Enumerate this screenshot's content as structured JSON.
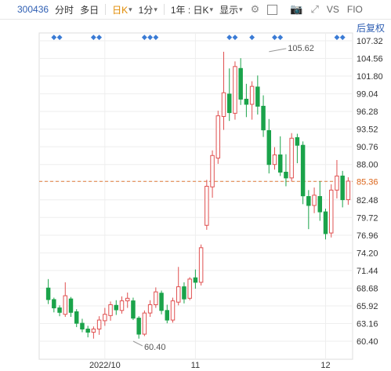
{
  "toolbar": {
    "code": "300436",
    "tabs": [
      "分时",
      "多日",
      "日K",
      "1分",
      "1年 : 日K",
      "显示"
    ],
    "active_tab": "日K",
    "right_labels": [
      "VS",
      "FIO"
    ]
  },
  "restore_label": "后复权",
  "colors": {
    "up": "#e05050",
    "down": "#1aa34a",
    "ref": "#e07a3a",
    "grid": "#eeeeee",
    "axis": "#333333",
    "marker": "#3a7bd5"
  },
  "chart_data": {
    "type": "candlestick",
    "y_ticks": [
      "107.32",
      "104.56",
      "101.80",
      "99.04",
      "96.28",
      "93.52",
      "90.76",
      "88.00",
      "85.36",
      "82.48",
      "79.72",
      "76.96",
      "74.20",
      "71.44",
      "68.68",
      "65.92",
      "63.16",
      "60.40"
    ],
    "ylim": [
      59.0,
      108.5
    ],
    "x_labels": [
      {
        "label": "2022/10",
        "index": 10
      },
      {
        "label": "11",
        "index": 26
      },
      {
        "label": "12",
        "index": 49
      }
    ],
    "ref_price": 85.36,
    "ref_label": "85.36",
    "max_annotation": {
      "label": "105.62",
      "index": 39,
      "value": 105.62
    },
    "min_annotation": {
      "label": "60.40",
      "index": 15,
      "value": 60.4
    },
    "event_markers": [
      1,
      2,
      8,
      9,
      17,
      18,
      19,
      32,
      33,
      36,
      40,
      41,
      51,
      52
    ],
    "candles": [
      [
        68.7,
        70.1,
        66.2,
        66.9
      ],
      [
        66.9,
        67.2,
        64.9,
        65.6
      ],
      [
        65.6,
        66.0,
        64.3,
        64.9
      ],
      [
        64.6,
        69.6,
        64.2,
        67.5
      ],
      [
        67.0,
        67.3,
        64.2,
        64.9
      ],
      [
        65.0,
        65.4,
        62.6,
        63.2
      ],
      [
        63.2,
        63.9,
        61.8,
        62.3
      ],
      [
        62.3,
        62.8,
        61.0,
        61.8
      ],
      [
        61.8,
        62.7,
        60.8,
        62.3
      ],
      [
        62.3,
        64.3,
        61.4,
        63.7
      ],
      [
        63.6,
        65.6,
        62.8,
        64.6
      ],
      [
        64.4,
        66.6,
        63.6,
        66.1
      ],
      [
        66.0,
        66.8,
        64.5,
        65.3
      ],
      [
        65.2,
        67.4,
        64.7,
        66.7
      ],
      [
        66.7,
        68.0,
        65.6,
        67.1
      ],
      [
        66.7,
        67.2,
        63.7,
        64.0
      ],
      [
        64.0,
        64.3,
        60.8,
        61.5
      ],
      [
        61.5,
        65.2,
        61.2,
        64.8
      ],
      [
        64.8,
        66.8,
        64.2,
        66.1
      ],
      [
        66.1,
        68.8,
        65.6,
        68.1
      ],
      [
        67.9,
        68.3,
        64.6,
        65.2
      ],
      [
        65.2,
        66.1,
        63.2,
        63.7
      ],
      [
        63.7,
        67.2,
        63.3,
        66.7
      ],
      [
        66.5,
        72.0,
        66.0,
        68.9
      ],
      [
        68.9,
        69.6,
        66.3,
        67.0
      ],
      [
        67.1,
        70.4,
        66.8,
        70.1
      ],
      [
        70.3,
        71.6,
        68.6,
        69.6
      ],
      [
        69.6,
        75.5,
        69.1,
        75.0
      ],
      [
        78.5,
        85.6,
        77.8,
        84.6
      ],
      [
        84.5,
        90.2,
        82.8,
        89.4
      ],
      [
        89.0,
        96.4,
        88.1,
        95.6
      ],
      [
        95.5,
        105.6,
        93.4,
        99.2
      ],
      [
        99.0,
        103.0,
        94.8,
        96.1
      ],
      [
        96.0,
        104.1,
        95.0,
        103.3
      ],
      [
        103.0,
        104.6,
        97.3,
        98.2
      ],
      [
        98.2,
        100.6,
        95.4,
        97.4
      ],
      [
        97.4,
        101.0,
        95.0,
        100.2
      ],
      [
        100.1,
        101.9,
        95.8,
        97.1
      ],
      [
        97.1,
        98.8,
        92.3,
        93.4
      ],
      [
        93.3,
        95.1,
        86.6,
        88.0
      ],
      [
        88.0,
        90.7,
        87.2,
        89.5
      ],
      [
        89.5,
        92.4,
        86.2,
        86.8
      ],
      [
        86.8,
        89.6,
        84.6,
        85.9
      ],
      [
        85.9,
        92.9,
        85.4,
        92.1
      ],
      [
        92.2,
        92.8,
        88.2,
        91.0
      ],
      [
        91.0,
        91.6,
        81.8,
        83.1
      ],
      [
        83.0,
        84.0,
        77.9,
        81.6
      ],
      [
        81.6,
        84.4,
        80.4,
        83.2
      ],
      [
        83.0,
        85.4,
        79.2,
        80.6
      ],
      [
        80.6,
        81.1,
        76.3,
        77.2
      ],
      [
        77.3,
        84.9,
        76.6,
        84.0
      ],
      [
        84.0,
        88.7,
        82.7,
        86.2
      ],
      [
        86.2,
        87.0,
        81.3,
        82.5
      ],
      [
        82.5,
        86.0,
        81.7,
        85.4
      ]
    ]
  }
}
